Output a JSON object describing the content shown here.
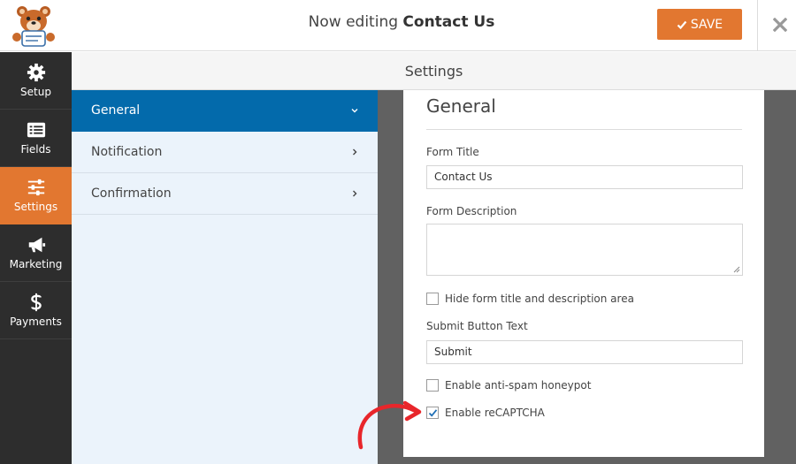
{
  "header": {
    "title_prefix": "Now editing",
    "title_form": "Contact Us",
    "save_label": "SAVE"
  },
  "sidebar": {
    "items": [
      {
        "label": "Setup",
        "icon": "gear-icon"
      },
      {
        "label": "Fields",
        "icon": "list-icon"
      },
      {
        "label": "Settings",
        "icon": "sliders-icon",
        "active": true
      },
      {
        "label": "Marketing",
        "icon": "megaphone-icon"
      },
      {
        "label": "Payments",
        "icon": "dollar-icon"
      }
    ]
  },
  "settings": {
    "heading": "Settings",
    "panels": [
      {
        "label": "General",
        "active": true
      },
      {
        "label": "Notification"
      },
      {
        "label": "Confirmation"
      }
    ]
  },
  "general": {
    "title": "General",
    "form_title_label": "Form Title",
    "form_title_value": "Contact Us",
    "form_description_label": "Form Description",
    "hide_title_label": "Hide form title and description area",
    "hide_title_checked": false,
    "submit_text_label": "Submit Button Text",
    "submit_text_value": "Submit",
    "honeypot_label": "Enable anti-spam honeypot",
    "honeypot_checked": false,
    "recaptcha_label": "Enable reCAPTCHA",
    "recaptcha_checked": true
  },
  "colors": {
    "accent_orange": "#e27730",
    "active_blue": "#036aab",
    "sidebar_dark": "#2d2d2d",
    "annotation_red": "#e8262b"
  }
}
